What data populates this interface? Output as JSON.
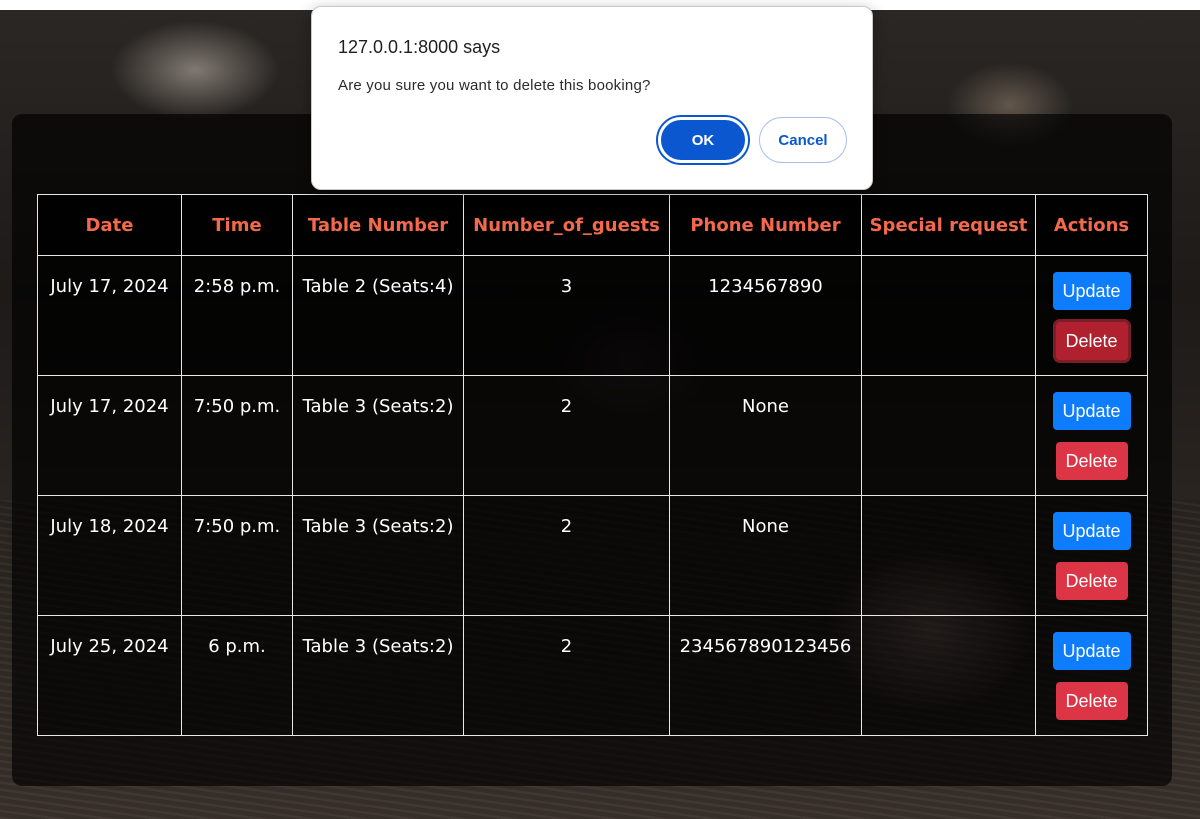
{
  "dialog": {
    "title": "127.0.0.1:8000 says",
    "message": "Are you sure you want to delete this booking?",
    "ok_label": "OK",
    "cancel_label": "Cancel"
  },
  "table": {
    "headers": [
      "Date",
      "Time",
      "Table Number",
      "Number_of_guests",
      "Phone Number",
      "Special request",
      "Actions"
    ],
    "rows": [
      {
        "date": "July 17, 2024",
        "time": "2:58 p.m.",
        "table": "Table 2 (Seats:4)",
        "guests": "3",
        "phone": "1234567890",
        "request": ""
      },
      {
        "date": "July 17, 2024",
        "time": "7:50 p.m.",
        "table": "Table 3 (Seats:2)",
        "guests": "2",
        "phone": "None",
        "request": ""
      },
      {
        "date": "July 18, 2024",
        "time": "7:50 p.m.",
        "table": "Table 3 (Seats:2)",
        "guests": "2",
        "phone": "None",
        "request": ""
      },
      {
        "date": "July 25, 2024",
        "time": "6 p.m.",
        "table": "Table 3 (Seats:2)",
        "guests": "2",
        "phone": "234567890123456",
        "request": ""
      }
    ],
    "update_label": "Update",
    "delete_label": "Delete"
  },
  "colors": {
    "header_text": "#f2694d",
    "update_button": "#0d7dfd",
    "delete_button": "#dc3545",
    "dialog_primary": "#0b57d0"
  }
}
